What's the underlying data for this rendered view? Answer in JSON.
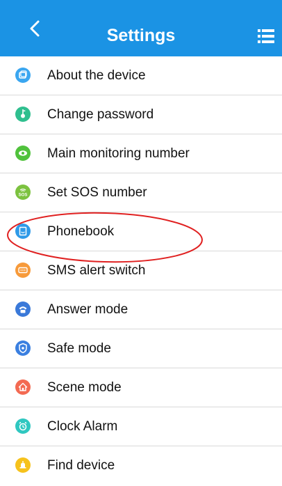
{
  "header": {
    "title": "Settings",
    "back_icon": "chevron-left-icon",
    "menu_icon": "list-menu-icon"
  },
  "items": [
    {
      "label": "About the device",
      "icon": "device-icon",
      "color": "#3aa6f0"
    },
    {
      "label": "Change password",
      "icon": "key-icon",
      "color": "#2fbf8f"
    },
    {
      "label": "Main monitoring number",
      "icon": "eye-icon",
      "color": "#50c23c"
    },
    {
      "label": "Set SOS number",
      "icon": "sos-icon",
      "color": "#7cc23f"
    },
    {
      "label": "Phonebook",
      "icon": "phonebook-icon",
      "color": "#2f9ae8"
    },
    {
      "label": "SMS alert switch",
      "icon": "sms-icon",
      "color": "#f79a3a"
    },
    {
      "label": "Answer mode",
      "icon": "answer-phone-icon",
      "color": "#3a79d9"
    },
    {
      "label": "Safe mode",
      "icon": "shield-icon",
      "color": "#3a7fe0"
    },
    {
      "label": "Scene mode",
      "icon": "home-icon",
      "color": "#f36a52"
    },
    {
      "label": "Clock Alarm",
      "icon": "alarm-clock-icon",
      "color": "#2fc7c0"
    },
    {
      "label": "Find device",
      "icon": "bell-icon",
      "color": "#f6c21c"
    }
  ],
  "sos_icon_text": "SOS",
  "annotation_color": "#e02020"
}
